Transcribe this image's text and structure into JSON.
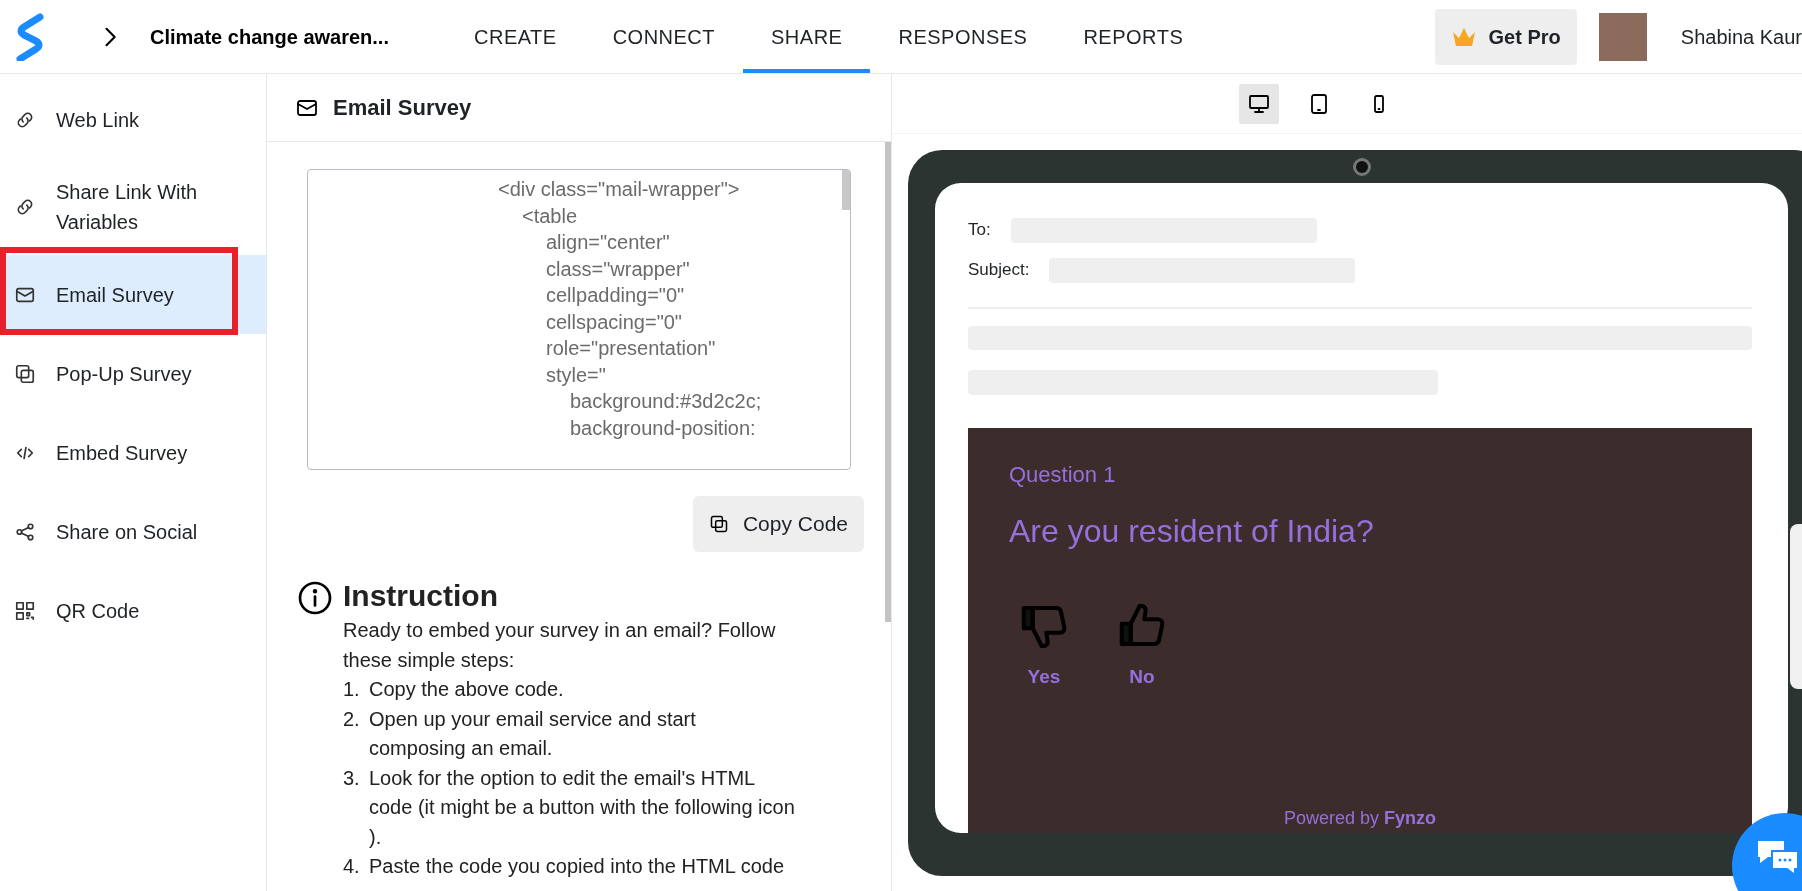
{
  "header": {
    "survey_title": "Climate change awaren...",
    "tabs": [
      {
        "label": "CREATE",
        "selected": false
      },
      {
        "label": "CONNECT",
        "selected": false
      },
      {
        "label": "SHARE",
        "selected": true
      },
      {
        "label": "RESPONSES",
        "selected": false
      },
      {
        "label": "REPORTS",
        "selected": false
      }
    ],
    "pro_button": "Get Pro",
    "user_name": "Shabina Kaur"
  },
  "sidebar": {
    "items": [
      {
        "kind": "link",
        "label": "Web Link",
        "selected": false,
        "highlighted": false
      },
      {
        "kind": "variables",
        "label": "Share Link With Variables",
        "selected": false,
        "highlighted": false
      },
      {
        "kind": "email",
        "label": "Email Survey",
        "selected": true,
        "highlighted": true
      },
      {
        "kind": "popup",
        "label": "Pop-Up Survey",
        "selected": false,
        "highlighted": false
      },
      {
        "kind": "embed",
        "label": "Embed Survey",
        "selected": false,
        "highlighted": false
      },
      {
        "kind": "social",
        "label": "Share on Social",
        "selected": false,
        "highlighted": false
      },
      {
        "kind": "qr",
        "label": "QR Code",
        "selected": false,
        "highlighted": false
      }
    ]
  },
  "panel": {
    "title": "Email Survey",
    "code": [
      {
        "text": "<div class=\"mail-wrapper\">",
        "children": [
          {
            "text": "<table",
            "children": [
              {
                "text": "align=\"center\""
              },
              {
                "text": "class=\"wrapper\""
              },
              {
                "text": "cellpadding=\"0\""
              },
              {
                "text": "cellspacing=\"0\""
              },
              {
                "text": "role=\"presentation\""
              },
              {
                "text": "style=\"",
                "children": [
                  {
                    "text": "background:#3d2c2c;"
                  },
                  {
                    "text": "background-position:"
                  }
                ]
              }
            ]
          }
        ]
      }
    ],
    "copy_button": "Copy Code",
    "instruction": {
      "heading": "Instruction",
      "intro": "Ready to embed your survey in an email? Follow these simple steps:",
      "steps": [
        {
          "number": "1.",
          "text": "Copy the above code."
        },
        {
          "number": "2.",
          "text": "Open up your email service and start composing an email."
        },
        {
          "number": "3.",
          "text": "Look for the option to edit the email's HTML code (it might be a button with the following icon )."
        },
        {
          "number": "4.",
          "text": "Paste the code you copied into the HTML code"
        }
      ]
    }
  },
  "preview": {
    "devices": [
      {
        "kind": "desktop",
        "selected": true
      },
      {
        "kind": "tablet",
        "selected": false
      },
      {
        "kind": "phone",
        "selected": false
      }
    ],
    "email": {
      "to_label": "To:",
      "subject_label": "Subject:",
      "question_number": "Question 1",
      "question": "Are you resident of India?",
      "options": [
        {
          "kind": "thumbs_down",
          "label": "Yes"
        },
        {
          "kind": "thumbs_up",
          "label": "No"
        }
      ],
      "powered_by": "Powered by **Fynzo**"
    }
  }
}
